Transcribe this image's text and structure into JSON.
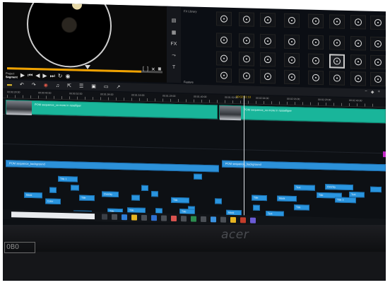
{
  "player": {
    "mode_labels": [
      "Project",
      "Segment"
    ],
    "active_mode": "Segment"
  },
  "library": {
    "header_label": "FX Library",
    "footer_label": "Feature"
  },
  "timeline": {
    "ruler_labels": [
      "00:00:28:00",
      "00:00:40:00",
      "00:00:52:00",
      "00:01:04:00",
      "00:01:16:00",
      "00:01:28:00",
      "00:01:40:00",
      "00:01:52:00",
      "00:02:04:00",
      "00:02:16:00",
      "00:02:28:00",
      "00:02:40:00"
    ],
    "playhead_time": "00:02:31:10",
    "video_clips": [
      {
        "name": "POM sequence_co more in roselliper"
      },
      {
        "name": "POM sequence_co more in rosselliper"
      }
    ],
    "audio_clips": [
      {
        "name": "POM sequence_background"
      },
      {
        "name": "POM sequence_background"
      }
    ],
    "title_blocks": [
      "Title 1",
      "Title 2",
      "Mask",
      "Title",
      "Overlay",
      "Color",
      "Title",
      "Text",
      "Overlay",
      "Title",
      "Title",
      "Mask",
      "Text",
      "Title",
      "Title",
      "Title 4",
      "Title",
      "Text",
      "Cross",
      "Title",
      "Mask",
      "Text",
      "Overlay",
      "Title",
      "Title 3",
      "Text",
      "Title",
      "Mask",
      "Title",
      "Text",
      "Title"
    ]
  },
  "brand": {
    "name": "acer"
  },
  "sticker": {
    "text": "OBO"
  },
  "colors": {
    "video_clip": "#19b59a",
    "audio_clip": "#2c91d9",
    "scrub_fill": "#f0a200",
    "marker": "#c428c8"
  }
}
